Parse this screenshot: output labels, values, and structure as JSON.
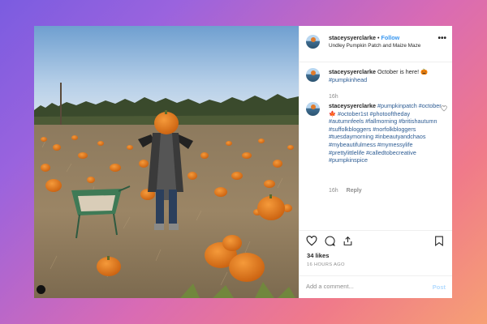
{
  "post": {
    "username": "staceysyerclarke",
    "separator": "•",
    "follow_label": "Follow",
    "location": "Undley Pumpkin Patch and Maize Maze",
    "more_icon": "more-options-icon"
  },
  "caption": {
    "username": "staceysyerclarke",
    "text": "October is here! 🎃",
    "hashtag": "#pumpkinhead",
    "time": "16h"
  },
  "comment": {
    "username": "staceysyerclarke",
    "hashtags": "#pumpkinpatch #october🍁 #october1st #photooftheday #autumnfeels #fallmorning #britishautumn #suffolkbloggers #norfolkbloggers #tuesdaymorning #inbeautyandchaos #mybeautifulmess #mymessylife #prettylittlelife #calledtobecreative #pumpkinspice",
    "time": "16h",
    "reply_label": "Reply"
  },
  "stats": {
    "likes": "34 likes",
    "posted_ago": "16 HOURS AGO"
  },
  "comment_box": {
    "placeholder": "Add a comment...",
    "post_label": "Post"
  },
  "colors": {
    "link": "#3897f0",
    "hashtag": "#2d5c93",
    "muted": "#8e8e8e"
  }
}
